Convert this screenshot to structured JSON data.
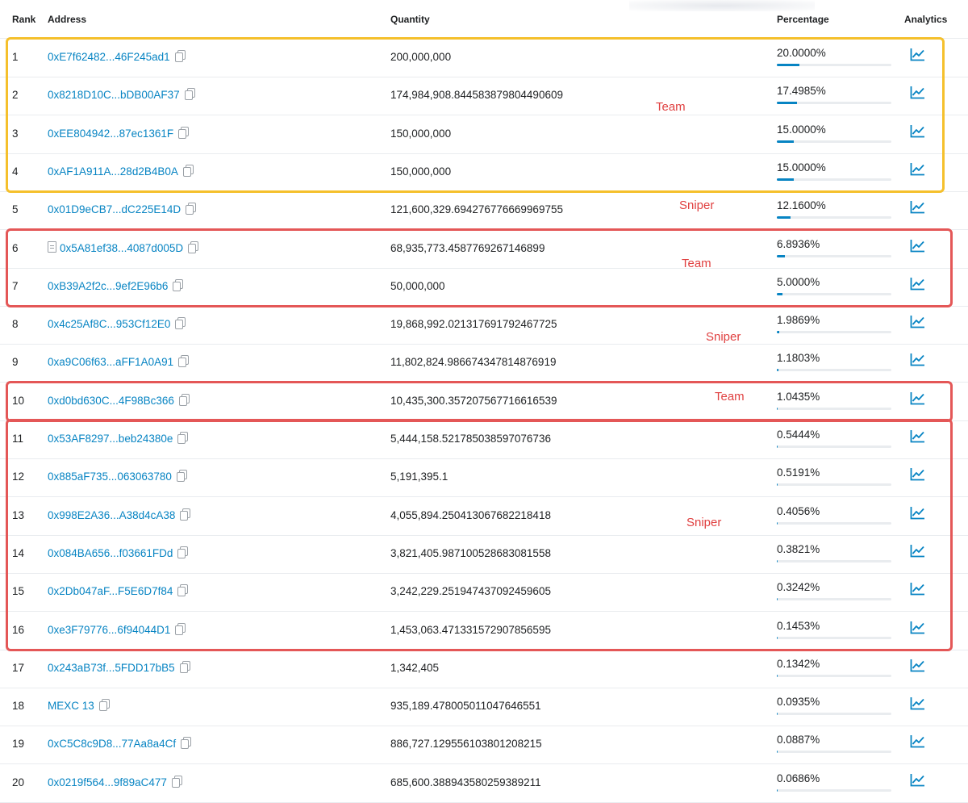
{
  "columns": {
    "rank": "Rank",
    "address": "Address",
    "quantity": "Quantity",
    "percentage": "Percentage",
    "analytics": "Analytics"
  },
  "colors": {
    "link": "#0784c3",
    "team_box": "#f5c02c",
    "group_box": "#e45757",
    "annotation_text": "#e04040"
  },
  "icons": [
    "copy-icon",
    "contract-file-icon",
    "analytics-chart-icon"
  ],
  "holders": [
    {
      "rank": "1",
      "address": "0xE7f62482...46F245ad1",
      "quantity": "200,000,000",
      "percentage": "20.0000%",
      "share": 20.0
    },
    {
      "rank": "2",
      "address": "0x8218D10C...bDB00AF37",
      "quantity": "174,984,908.844583879804490609",
      "percentage": "17.4985%",
      "share": 17.4985
    },
    {
      "rank": "3",
      "address": "0xEE804942...87ec1361F",
      "quantity": "150,000,000",
      "percentage": "15.0000%",
      "share": 15.0
    },
    {
      "rank": "4",
      "address": "0xAF1A911A...28d2B4B0A",
      "quantity": "150,000,000",
      "percentage": "15.0000%",
      "share": 15.0
    },
    {
      "rank": "5",
      "address": "0x01D9eCB7...dC225E14D",
      "quantity": "121,600,329.694276776669969755",
      "percentage": "12.1600%",
      "share": 12.16
    },
    {
      "rank": "6",
      "address": "0x5A81ef38...4087d005D",
      "quantity": "68,935,773.4587769267146899",
      "percentage": "6.8936%",
      "share": 6.8936,
      "contract": true
    },
    {
      "rank": "7",
      "address": "0xB39A2f2c...9ef2E96b6",
      "quantity": "50,000,000",
      "percentage": "5.0000%",
      "share": 5.0
    },
    {
      "rank": "8",
      "address": "0x4c25Af8C...953Cf12E0",
      "quantity": "19,868,992.021317691792467725",
      "percentage": "1.9869%",
      "share": 1.9869
    },
    {
      "rank": "9",
      "address": "0xa9C06f63...aFF1A0A91",
      "quantity": "11,802,824.986674347814876919",
      "percentage": "1.1803%",
      "share": 1.1803
    },
    {
      "rank": "10",
      "address": "0xd0bd630C...4F98Bc366",
      "quantity": "10,435,300.357207567716616539",
      "percentage": "1.0435%",
      "share": 1.0435
    },
    {
      "rank": "11",
      "address": "0x53AF8297...beb24380e",
      "quantity": "5,444,158.521785038597076736",
      "percentage": "0.5444%",
      "share": 0.5444
    },
    {
      "rank": "12",
      "address": "0x885aF735...063063780",
      "quantity": "5,191,395.1",
      "percentage": "0.5191%",
      "share": 0.5191
    },
    {
      "rank": "13",
      "address": "0x998E2A36...A38d4cA38",
      "quantity": "4,055,894.250413067682218418",
      "percentage": "0.4056%",
      "share": 0.4056
    },
    {
      "rank": "14",
      "address": "0x084BA656...f03661FDd",
      "quantity": "3,821,405.987100528683081558",
      "percentage": "0.3821%",
      "share": 0.3821
    },
    {
      "rank": "15",
      "address": "0x2Db047aF...F5E6D7f84",
      "quantity": "3,242,229.251947437092459605",
      "percentage": "0.3242%",
      "share": 0.3242
    },
    {
      "rank": "16",
      "address": "0xe3F79776...6f94044D1",
      "quantity": "1,453,063.471331572907856595",
      "percentage": "0.1453%",
      "share": 0.1453
    },
    {
      "rank": "17",
      "address": "0x243aB73f...5FDD17bB5",
      "quantity": "1,342,405",
      "percentage": "0.1342%",
      "share": 0.1342
    },
    {
      "rank": "18",
      "address": "MEXC 13",
      "quantity": "935,189.478005011047646551",
      "percentage": "0.0935%",
      "share": 0.0935
    },
    {
      "rank": "19",
      "address": "0xC5C8c9D8...77Aa8a4Cf",
      "quantity": "886,727.129556103801208215",
      "percentage": "0.0887%",
      "share": 0.0887
    },
    {
      "rank": "20",
      "address": "0x0219f564...9f89aC477",
      "quantity": "685,600.388943580259389211",
      "percentage": "0.0686%",
      "share": 0.0686
    }
  ],
  "annotations": [
    {
      "text": "Team",
      "style": "gold",
      "first_rank": 1,
      "last_rank": 4
    },
    {
      "text": "Sniper",
      "first_rank": 5,
      "last_rank": 5
    },
    {
      "text": "Team",
      "style": "red",
      "first_rank": 6,
      "last_rank": 7
    },
    {
      "text": "Sniper",
      "first_rank": 8,
      "last_rank": 9
    },
    {
      "text": "Team",
      "style": "red",
      "first_rank": 10,
      "last_rank": 10
    },
    {
      "text": "Sniper",
      "style": "red",
      "first_rank": 11,
      "last_rank": 16
    }
  ]
}
